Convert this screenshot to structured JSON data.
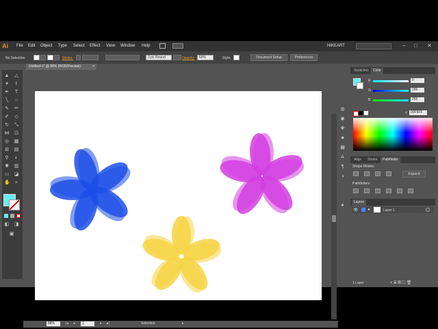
{
  "app": {
    "logo": "Ai",
    "workspace": "HIKEART"
  },
  "menu": [
    "File",
    "Edit",
    "Object",
    "Type",
    "Select",
    "Effect",
    "View",
    "Window",
    "Help"
  ],
  "window_controls": [
    "–",
    "□",
    "✕"
  ],
  "control_bar": {
    "selection": "No Selection",
    "stroke_label": "Stroke:",
    "brush": "3 pt. Round",
    "opacity_label": "Opacity:",
    "opacity_value": "60%",
    "style_label": "Style:",
    "document_setup": "Document Setup",
    "preferences": "Preferences"
  },
  "document": {
    "tab_title": "Untitled-1* @ 88% (RGB/Preview)",
    "close": "×"
  },
  "status": {
    "zoom": "88%",
    "artboard": "1",
    "tool": "Selection"
  },
  "panels": {
    "color": {
      "tabs": [
        "Swatches",
        "Color"
      ],
      "r_label": "R",
      "r_value": "0",
      "g_label": "G",
      "g_value": "245",
      "b_label": "B",
      "b_value": "255",
      "hex": "00F5FF"
    },
    "pathfinder": {
      "tabs": [
        "Align",
        "Stroke",
        "Pathfinder"
      ],
      "shape_modes": "Shape Modes:",
      "expand": "Expand",
      "pathfinders": "Pathfinders:"
    },
    "layers": {
      "tab": "Layers",
      "layer_name": "Layer 1",
      "count": "1 Layer"
    }
  },
  "colors": {
    "fill": "#67ecf5",
    "stroke": "#e00000",
    "flower_blue": "#1c4fe6",
    "flower_yellow": "#f7d443",
    "flower_magenta": "#d23ee0"
  }
}
